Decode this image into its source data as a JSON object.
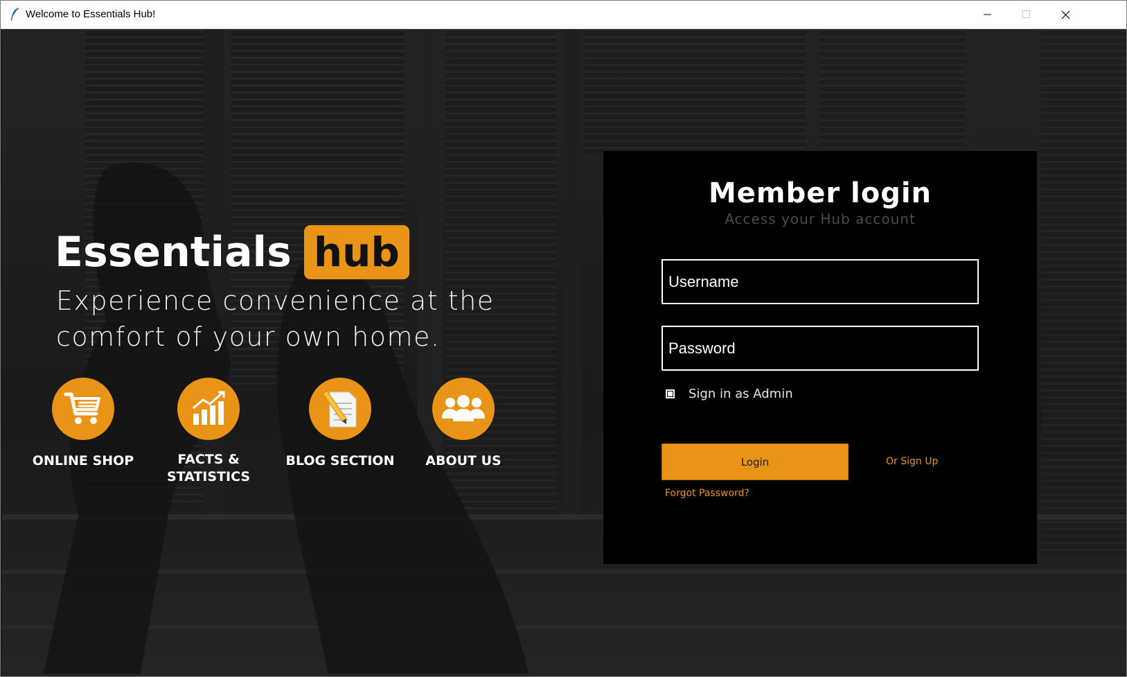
{
  "window": {
    "title": "Welcome to Essentials Hub!",
    "icon": "feather-icon",
    "controls": [
      "minimize-icon",
      "maximize-icon",
      "close-icon"
    ]
  },
  "hero": {
    "brand_word": "Essentials",
    "brand_badge": "hub",
    "tagline": "Experience convenience at the comfort of your own home.",
    "features": [
      {
        "label": "ONLINE SHOP",
        "icon": "shopping-cart-icon"
      },
      {
        "label": "FACTS & STATISTICS",
        "icon": "bar-chart-icon"
      },
      {
        "label": "BLOG SECTION",
        "icon": "document-pencil-icon"
      },
      {
        "label": "ABOUT US",
        "icon": "group-icon"
      }
    ]
  },
  "login": {
    "title": "Member login",
    "subtitle": "Access your Hub account",
    "username_placeholder": "Username",
    "password_placeholder": "Password",
    "admin_label": "Sign in as Admin",
    "login_button": "Login",
    "signup_link": "Or Sign Up",
    "forgot_link": "Forgot Password?"
  },
  "colors": {
    "accent": "#ea9417",
    "panel": "#000000",
    "text": "#ffffff"
  }
}
